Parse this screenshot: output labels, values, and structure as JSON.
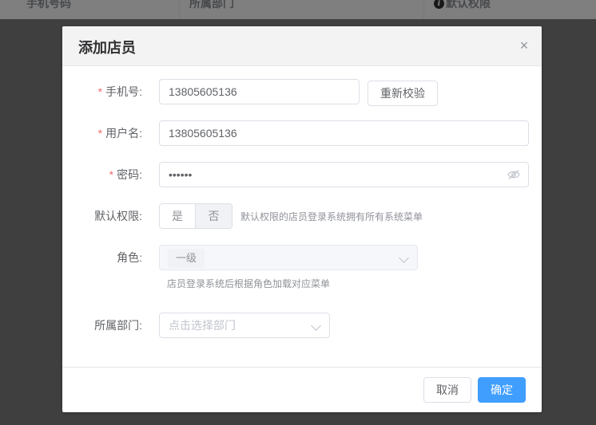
{
  "background_table": {
    "columns": [
      "手机号码",
      "所属部门",
      "默认权限"
    ],
    "info_glyph": "i"
  },
  "dialog": {
    "title": "添加店员",
    "close_glyph": "×",
    "phone": {
      "required_mark": "*",
      "label": "手机号:",
      "value": "13805605136",
      "recheck_button": "重新校验"
    },
    "username": {
      "required_mark": "*",
      "label": "用户名:",
      "value": "13805605136"
    },
    "password": {
      "required_mark": "*",
      "label": "密码:",
      "value": "••••••",
      "toggle_icon": "eye-off-icon"
    },
    "default_permission": {
      "label": "默认权限:",
      "options": [
        "是",
        "否"
      ],
      "selected": "否",
      "hint": "默认权限的店员登录系统拥有所有系统菜单"
    },
    "role": {
      "label": "角色:",
      "selected_tag": "一级",
      "hint": "店员登录系统后根据角色加载对应菜单"
    },
    "department": {
      "label": "所属部门:",
      "placeholder": "点击选择部门"
    },
    "footer": {
      "cancel": "取消",
      "confirm": "确定"
    }
  },
  "colors": {
    "primary": "#409eff",
    "required": "#f56c6c"
  }
}
